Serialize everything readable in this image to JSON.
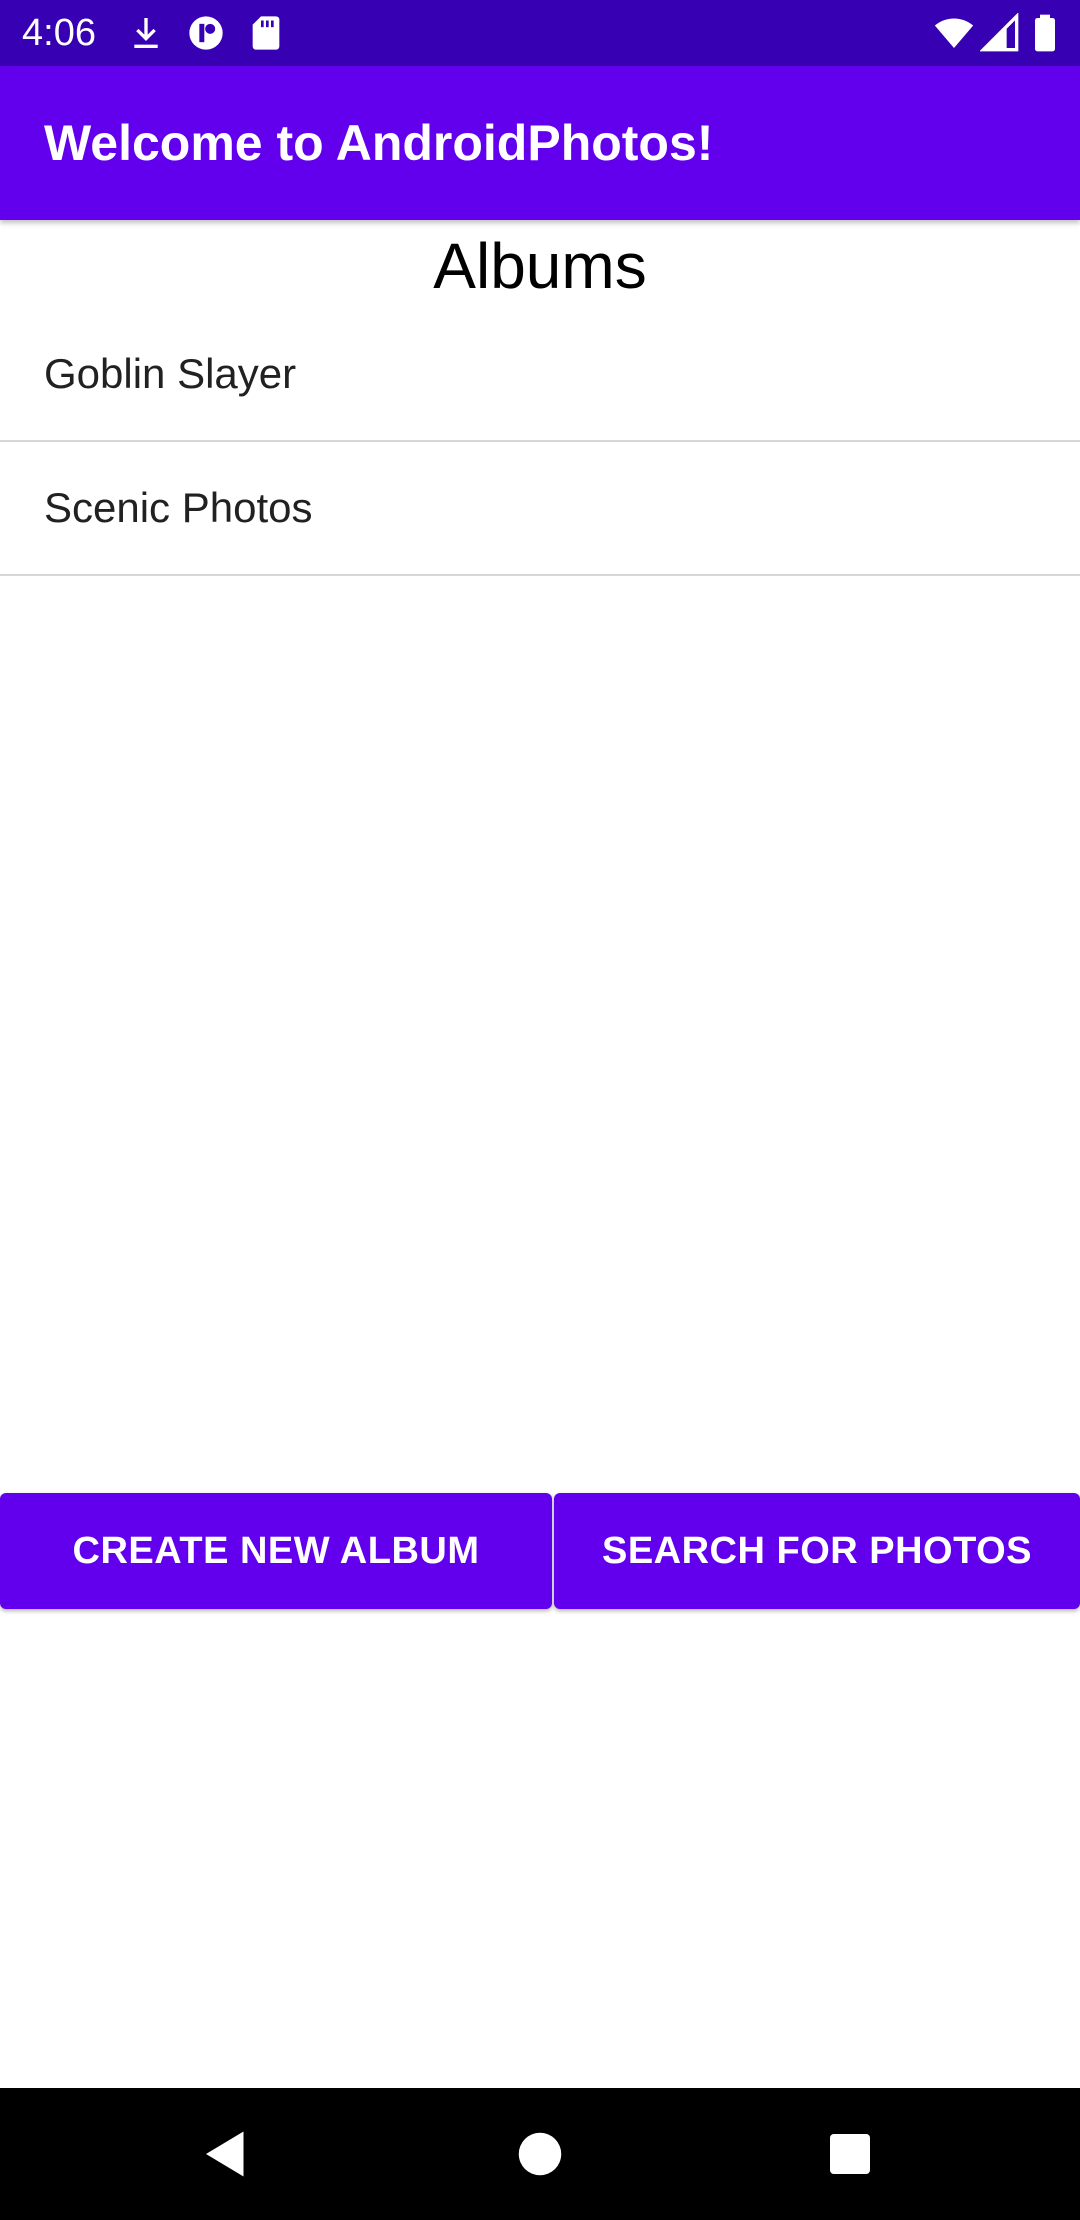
{
  "status_bar": {
    "time": "4:06",
    "icons_left": [
      "download-icon",
      "app-notification-icon",
      "sd-card-icon"
    ],
    "icons_right": [
      "wifi-icon",
      "signal-icon",
      "battery-icon"
    ]
  },
  "app_bar": {
    "title": "Welcome to AndroidPhotos!"
  },
  "albums": {
    "heading": "Albums",
    "items": [
      {
        "label": "Goblin Slayer"
      },
      {
        "label": "Scenic Photos"
      }
    ]
  },
  "actions": {
    "create_label": "CREATE NEW ALBUM",
    "search_label": "SEARCH FOR PHOTOS"
  },
  "nav_bar": {
    "icons": [
      "back-icon",
      "home-icon",
      "recents-icon"
    ]
  },
  "colors": {
    "status_bar": "#3700b3",
    "primary": "#6200ee",
    "divider": "#d6d6d6"
  }
}
